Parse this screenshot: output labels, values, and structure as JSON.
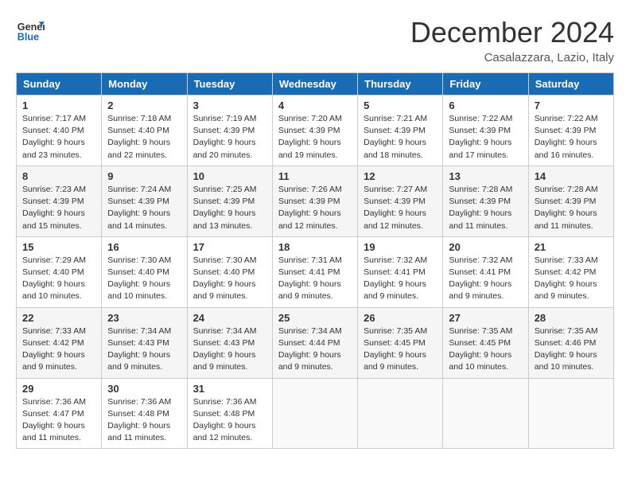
{
  "header": {
    "logo_line1": "General",
    "logo_line2": "Blue",
    "month": "December 2024",
    "location": "Casalazzara, Lazio, Italy"
  },
  "weekdays": [
    "Sunday",
    "Monday",
    "Tuesday",
    "Wednesday",
    "Thursday",
    "Friday",
    "Saturday"
  ],
  "weeks": [
    [
      {
        "day": "1",
        "sunrise": "Sunrise: 7:17 AM",
        "sunset": "Sunset: 4:40 PM",
        "daylight": "Daylight: 9 hours and 23 minutes."
      },
      {
        "day": "2",
        "sunrise": "Sunrise: 7:18 AM",
        "sunset": "Sunset: 4:40 PM",
        "daylight": "Daylight: 9 hours and 22 minutes."
      },
      {
        "day": "3",
        "sunrise": "Sunrise: 7:19 AM",
        "sunset": "Sunset: 4:39 PM",
        "daylight": "Daylight: 9 hours and 20 minutes."
      },
      {
        "day": "4",
        "sunrise": "Sunrise: 7:20 AM",
        "sunset": "Sunset: 4:39 PM",
        "daylight": "Daylight: 9 hours and 19 minutes."
      },
      {
        "day": "5",
        "sunrise": "Sunrise: 7:21 AM",
        "sunset": "Sunset: 4:39 PM",
        "daylight": "Daylight: 9 hours and 18 minutes."
      },
      {
        "day": "6",
        "sunrise": "Sunrise: 7:22 AM",
        "sunset": "Sunset: 4:39 PM",
        "daylight": "Daylight: 9 hours and 17 minutes."
      },
      {
        "day": "7",
        "sunrise": "Sunrise: 7:22 AM",
        "sunset": "Sunset: 4:39 PM",
        "daylight": "Daylight: 9 hours and 16 minutes."
      }
    ],
    [
      {
        "day": "8",
        "sunrise": "Sunrise: 7:23 AM",
        "sunset": "Sunset: 4:39 PM",
        "daylight": "Daylight: 9 hours and 15 minutes."
      },
      {
        "day": "9",
        "sunrise": "Sunrise: 7:24 AM",
        "sunset": "Sunset: 4:39 PM",
        "daylight": "Daylight: 9 hours and 14 minutes."
      },
      {
        "day": "10",
        "sunrise": "Sunrise: 7:25 AM",
        "sunset": "Sunset: 4:39 PM",
        "daylight": "Daylight: 9 hours and 13 minutes."
      },
      {
        "day": "11",
        "sunrise": "Sunrise: 7:26 AM",
        "sunset": "Sunset: 4:39 PM",
        "daylight": "Daylight: 9 hours and 12 minutes."
      },
      {
        "day": "12",
        "sunrise": "Sunrise: 7:27 AM",
        "sunset": "Sunset: 4:39 PM",
        "daylight": "Daylight: 9 hours and 12 minutes."
      },
      {
        "day": "13",
        "sunrise": "Sunrise: 7:28 AM",
        "sunset": "Sunset: 4:39 PM",
        "daylight": "Daylight: 9 hours and 11 minutes."
      },
      {
        "day": "14",
        "sunrise": "Sunrise: 7:28 AM",
        "sunset": "Sunset: 4:39 PM",
        "daylight": "Daylight: 9 hours and 11 minutes."
      }
    ],
    [
      {
        "day": "15",
        "sunrise": "Sunrise: 7:29 AM",
        "sunset": "Sunset: 4:40 PM",
        "daylight": "Daylight: 9 hours and 10 minutes."
      },
      {
        "day": "16",
        "sunrise": "Sunrise: 7:30 AM",
        "sunset": "Sunset: 4:40 PM",
        "daylight": "Daylight: 9 hours and 10 minutes."
      },
      {
        "day": "17",
        "sunrise": "Sunrise: 7:30 AM",
        "sunset": "Sunset: 4:40 PM",
        "daylight": "Daylight: 9 hours and 9 minutes."
      },
      {
        "day": "18",
        "sunrise": "Sunrise: 7:31 AM",
        "sunset": "Sunset: 4:41 PM",
        "daylight": "Daylight: 9 hours and 9 minutes."
      },
      {
        "day": "19",
        "sunrise": "Sunrise: 7:32 AM",
        "sunset": "Sunset: 4:41 PM",
        "daylight": "Daylight: 9 hours and 9 minutes."
      },
      {
        "day": "20",
        "sunrise": "Sunrise: 7:32 AM",
        "sunset": "Sunset: 4:41 PM",
        "daylight": "Daylight: 9 hours and 9 minutes."
      },
      {
        "day": "21",
        "sunrise": "Sunrise: 7:33 AM",
        "sunset": "Sunset: 4:42 PM",
        "daylight": "Daylight: 9 hours and 9 minutes."
      }
    ],
    [
      {
        "day": "22",
        "sunrise": "Sunrise: 7:33 AM",
        "sunset": "Sunset: 4:42 PM",
        "daylight": "Daylight: 9 hours and 9 minutes."
      },
      {
        "day": "23",
        "sunrise": "Sunrise: 7:34 AM",
        "sunset": "Sunset: 4:43 PM",
        "daylight": "Daylight: 9 hours and 9 minutes."
      },
      {
        "day": "24",
        "sunrise": "Sunrise: 7:34 AM",
        "sunset": "Sunset: 4:43 PM",
        "daylight": "Daylight: 9 hours and 9 minutes."
      },
      {
        "day": "25",
        "sunrise": "Sunrise: 7:34 AM",
        "sunset": "Sunset: 4:44 PM",
        "daylight": "Daylight: 9 hours and 9 minutes."
      },
      {
        "day": "26",
        "sunrise": "Sunrise: 7:35 AM",
        "sunset": "Sunset: 4:45 PM",
        "daylight": "Daylight: 9 hours and 9 minutes."
      },
      {
        "day": "27",
        "sunrise": "Sunrise: 7:35 AM",
        "sunset": "Sunset: 4:45 PM",
        "daylight": "Daylight: 9 hours and 10 minutes."
      },
      {
        "day": "28",
        "sunrise": "Sunrise: 7:35 AM",
        "sunset": "Sunset: 4:46 PM",
        "daylight": "Daylight: 9 hours and 10 minutes."
      }
    ],
    [
      {
        "day": "29",
        "sunrise": "Sunrise: 7:36 AM",
        "sunset": "Sunset: 4:47 PM",
        "daylight": "Daylight: 9 hours and 11 minutes."
      },
      {
        "day": "30",
        "sunrise": "Sunrise: 7:36 AM",
        "sunset": "Sunset: 4:48 PM",
        "daylight": "Daylight: 9 hours and 11 minutes."
      },
      {
        "day": "31",
        "sunrise": "Sunrise: 7:36 AM",
        "sunset": "Sunset: 4:48 PM",
        "daylight": "Daylight: 9 hours and 12 minutes."
      },
      null,
      null,
      null,
      null
    ]
  ]
}
